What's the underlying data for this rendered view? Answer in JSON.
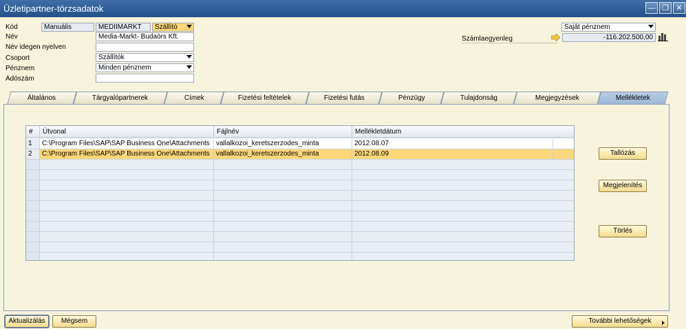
{
  "window": {
    "title": "Üzletipartner-törzsadatok",
    "minimize": "—",
    "restore": "❐",
    "close": "✕"
  },
  "header": {
    "kod_label": "Kód",
    "kod_type": "Manuális",
    "kod_value": "MEDIIMARKT",
    "bp_type": "Szállító",
    "nev_label": "Név",
    "nev_value": "Media-Markt- Budaörs Kft.",
    "nev_idegen_label": "Név idegen nyelven",
    "nev_idegen_value": "",
    "csoport_label": "Csoport",
    "csoport_value": "Szállítók",
    "penznem_label": "Pénznem",
    "penznem_value": "Minden pénznem",
    "adoszam_label": "Adószám",
    "adoszam_value": "",
    "currency_select": "Saját pénznem",
    "balance_label": "Számlaegyenleg",
    "balance_value": "-116.202.500,00"
  },
  "tabs": [
    "Általános",
    "Tárgyalópartnerek",
    "Címek",
    "Fizetési feltételek",
    "Fizetési futás",
    "Pénzügy",
    "Tulajdonság",
    "Megjegyzések",
    "Mellékletek"
  ],
  "active_tab": "Mellékletek",
  "attachments": {
    "columns": [
      "#",
      "Útvonal",
      "Fájlnév",
      "Mellékletdátum"
    ],
    "rows": [
      {
        "num": "1",
        "path": "C:\\Program Files\\SAP\\SAP Business One\\Attachments",
        "file": "vallalkozoi_keretszerzodes_minta",
        "date": "2012.08.07"
      },
      {
        "num": "2",
        "path": "C:\\Program Files\\SAP\\SAP Business One\\Attachments",
        "file": "vallalkozoi_keretszerzodes_minta",
        "date": "2012.08.09"
      }
    ]
  },
  "side_buttons": {
    "browse": "Tallózás",
    "display": "Megjelenítés",
    "delete": "Törlés"
  },
  "footer": {
    "update": "Aktualizálás",
    "cancel": "Mégsem",
    "more": "További lehetőségek"
  },
  "colors": {
    "accent": "#23508a",
    "selected_row": "#fbd779",
    "background": "#f8f3dc"
  }
}
